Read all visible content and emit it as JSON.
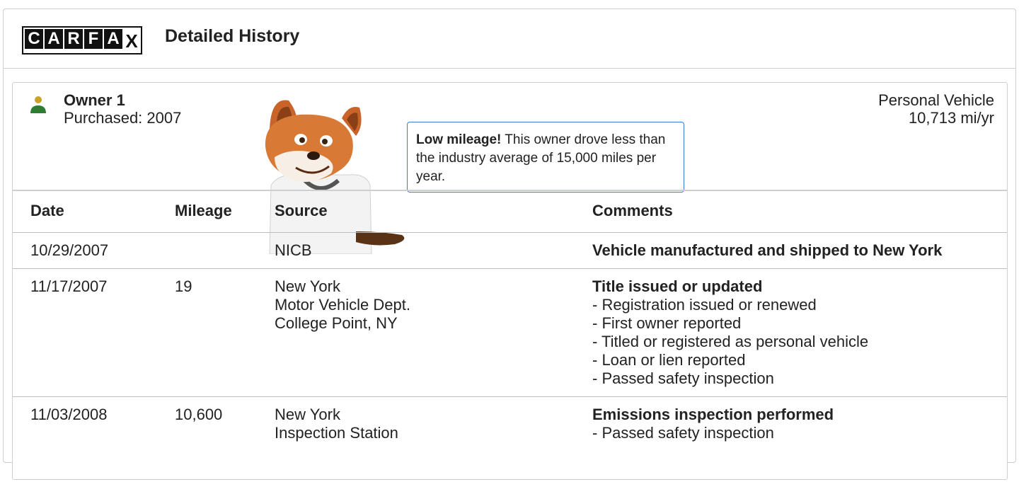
{
  "header": {
    "logo_letters": [
      "C",
      "A",
      "R",
      "F",
      "A",
      "X"
    ],
    "title": "Detailed History"
  },
  "owner": {
    "name": "Owner 1",
    "purchased": "Purchased: 2007",
    "vehicle_type": "Personal Vehicle",
    "mileage_per_year": "10,713 mi/yr",
    "icon": "person-icon"
  },
  "tooltip": {
    "bold": "Low mileage!",
    "text": " This owner drove less than the industry average of 15,000 miles per year."
  },
  "table": {
    "headers": {
      "date": "Date",
      "mileage": "Mileage",
      "source": "Source",
      "comments": "Comments"
    },
    "rows": [
      {
        "date": "10/29/2007",
        "mileage": "",
        "source": [
          "NICB"
        ],
        "comment_title": "Vehicle manufactured and shipped to New York",
        "comment_items": []
      },
      {
        "date": "11/17/2007",
        "mileage": "19",
        "source": [
          "New York",
          "Motor Vehicle Dept.",
          "College Point, NY"
        ],
        "comment_title": "Title issued or updated",
        "comment_items": [
          "- Registration issued or renewed",
          "- First owner reported",
          "- Titled or registered as personal vehicle",
          "- Loan or lien reported",
          "- Passed safety inspection"
        ]
      },
      {
        "date": "11/03/2008",
        "mileage": "10,600",
        "source": [
          "New York",
          "Inspection Station"
        ],
        "comment_title": "Emissions inspection performed",
        "comment_items": [
          "- Passed safety inspection"
        ]
      }
    ]
  },
  "colors": {
    "person_head": "#c9a227",
    "person_body": "#2e7d32",
    "tooltip_border": "#3b7bd4"
  }
}
